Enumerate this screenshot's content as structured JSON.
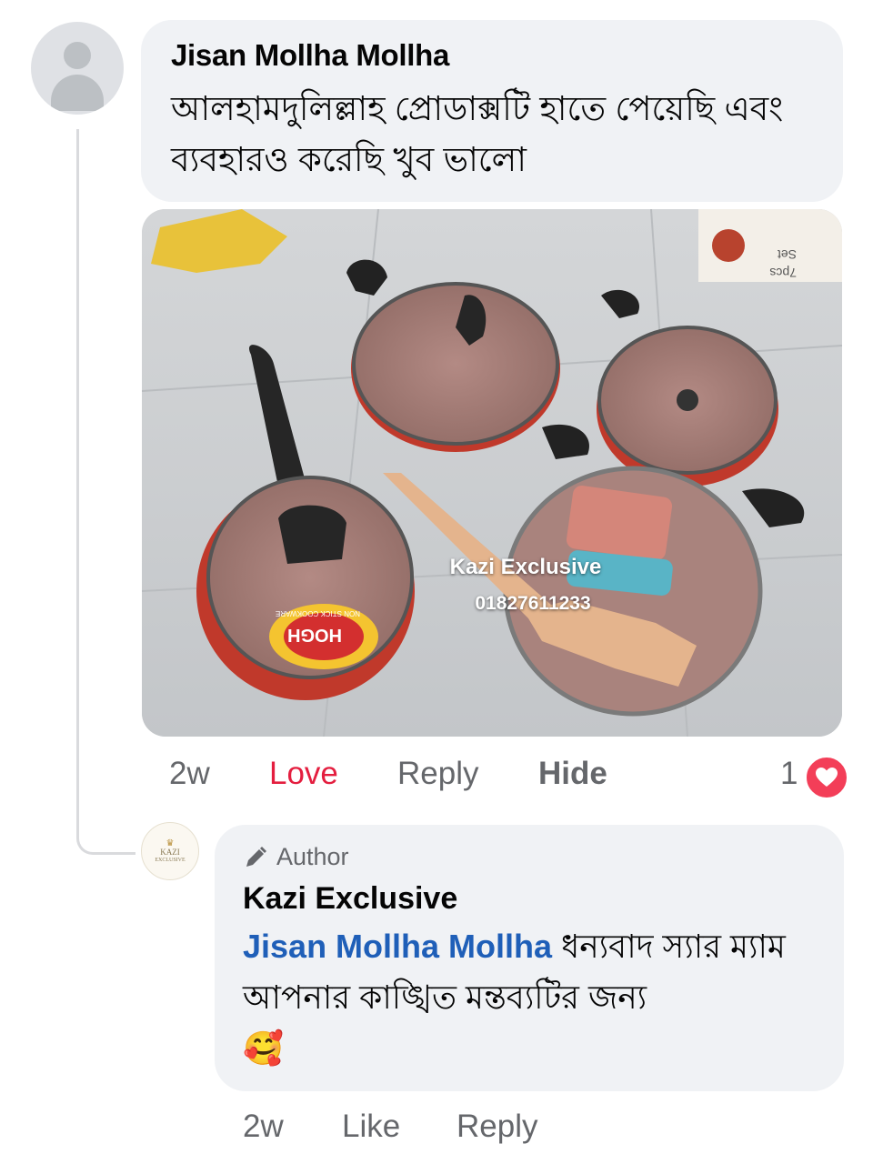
{
  "comment": {
    "author": "Jisan Mollha Mollha",
    "text": "আলহামদুলিল্লাহ প্রোডাক্সটি হাতে পেয়েছি এবং ব্যবহারও করেছি খুব ভালো",
    "time": "2w",
    "love_label": "Love",
    "reply_label": "Reply",
    "hide_label": "Hide",
    "reaction_count": "1",
    "photo": {
      "box_text_1": "7pcs",
      "box_text_2": "Set",
      "lid_brand": "HOGH",
      "lid_sub": "NON STICK COOKWARE",
      "watermark_name": "Kazi Exclusive",
      "watermark_phone": "01827611233"
    }
  },
  "reply": {
    "badge": "Author",
    "author": "Kazi Exclusive",
    "mention": "Jisan Mollha Mollha",
    "text": " ধন্যবাদ স্যার ম্যাম আপনার কাঙ্খিত মন্তব্যটির জন্য",
    "emoji": "🥰",
    "avatar_text": "KAZI",
    "avatar_sub": "EXCLUSIVE",
    "time": "2w",
    "like_label": "Like",
    "reply_label": "Reply"
  },
  "colors": {
    "bubble": "#f0f2f5",
    "love": "#e41e3f",
    "mention": "#1f5fb8",
    "meta": "#65676b",
    "heart": "#f33e58"
  }
}
